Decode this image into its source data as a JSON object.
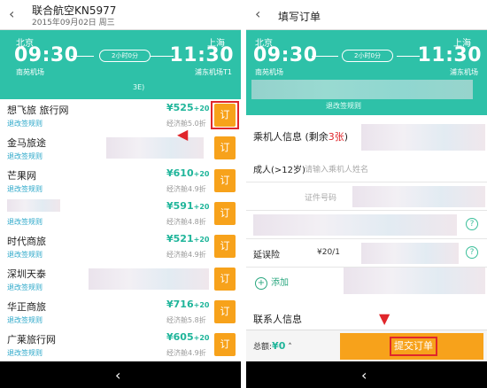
{
  "left": {
    "header": {
      "back_glyph": "‹",
      "title": "联合航空KN5977",
      "subtitle": "2015年09月02日 周三"
    },
    "banner": {
      "from_city": "北京",
      "from_time": "09:30",
      "from_airport": "南苑机场",
      "to_city": "上海",
      "to_time": "11:30",
      "to_airport": "浦东机场T1",
      "duration": "2小时0分",
      "tail_note": "3E)"
    },
    "agencies": [
      {
        "name": "想飞旅 旅行网",
        "rules": "退改签规则",
        "price": "¥525",
        "plus": "+20",
        "discount": "经济舱5.0折",
        "book": "订"
      },
      {
        "name": "金马旅途",
        "rules": "退改签规则",
        "price": "",
        "plus": "",
        "discount": "",
        "book": "订"
      },
      {
        "name": "芒果网",
        "rules": "退改签规则",
        "price": "¥610",
        "plus": "+20",
        "discount": "经济舱4.9折",
        "book": "订"
      },
      {
        "name": "",
        "rules": "退改签规则",
        "price": "¥591",
        "plus": "+20",
        "discount": "经济舱4.8折",
        "book": "订"
      },
      {
        "name": "时代商旅",
        "rules": "退改签规则",
        "price": "¥521",
        "plus": "+20",
        "discount": "经济舱4.9折",
        "book": "订"
      },
      {
        "name": "深圳天泰",
        "rules": "退改签规则",
        "price": "",
        "plus": "",
        "discount": "",
        "book": "订"
      },
      {
        "name": "华正商旅",
        "rules": "退改签规则",
        "price": "¥716",
        "plus": "+20",
        "discount": "经济舱5.8折",
        "book": "订"
      },
      {
        "name": "广莱旅行网",
        "rules": "退改签规则",
        "price": "¥605",
        "plus": "+20",
        "discount": "经济舱4.9折",
        "book": "订"
      }
    ],
    "nav_back_glyph": "‹"
  },
  "right": {
    "header": {
      "back_glyph": "‹",
      "title": "填写订单"
    },
    "banner": {
      "from_city": "北京",
      "from_time": "09:30",
      "from_airport": "南苑机场",
      "to_city": "上海",
      "to_time": "11:30",
      "to_airport": "浦东机场",
      "duration": "2小时0分",
      "rules_link": "退改签规则"
    },
    "passenger_title_prefix": "乘机人信息 (剩余",
    "passenger_count": "3张",
    "passenger_title_suffix": ")",
    "fields": {
      "adult_label": "成人(>12岁)",
      "name_placeholder": "请输入乘机人姓名",
      "id_placeholder": "证件号码",
      "delay_label": "延误险",
      "delay_value": "¥20/1"
    },
    "add_label": "添加",
    "contact_title": "联系人信息",
    "total_label": "总额:",
    "total_amount": "¥0",
    "submit_label": "提交订单",
    "nav_back_glyph": "‹"
  },
  "accent": {
    "teal": "#2ec1a8",
    "orange": "#f7a21b",
    "highlight_red": "#e0262b"
  }
}
